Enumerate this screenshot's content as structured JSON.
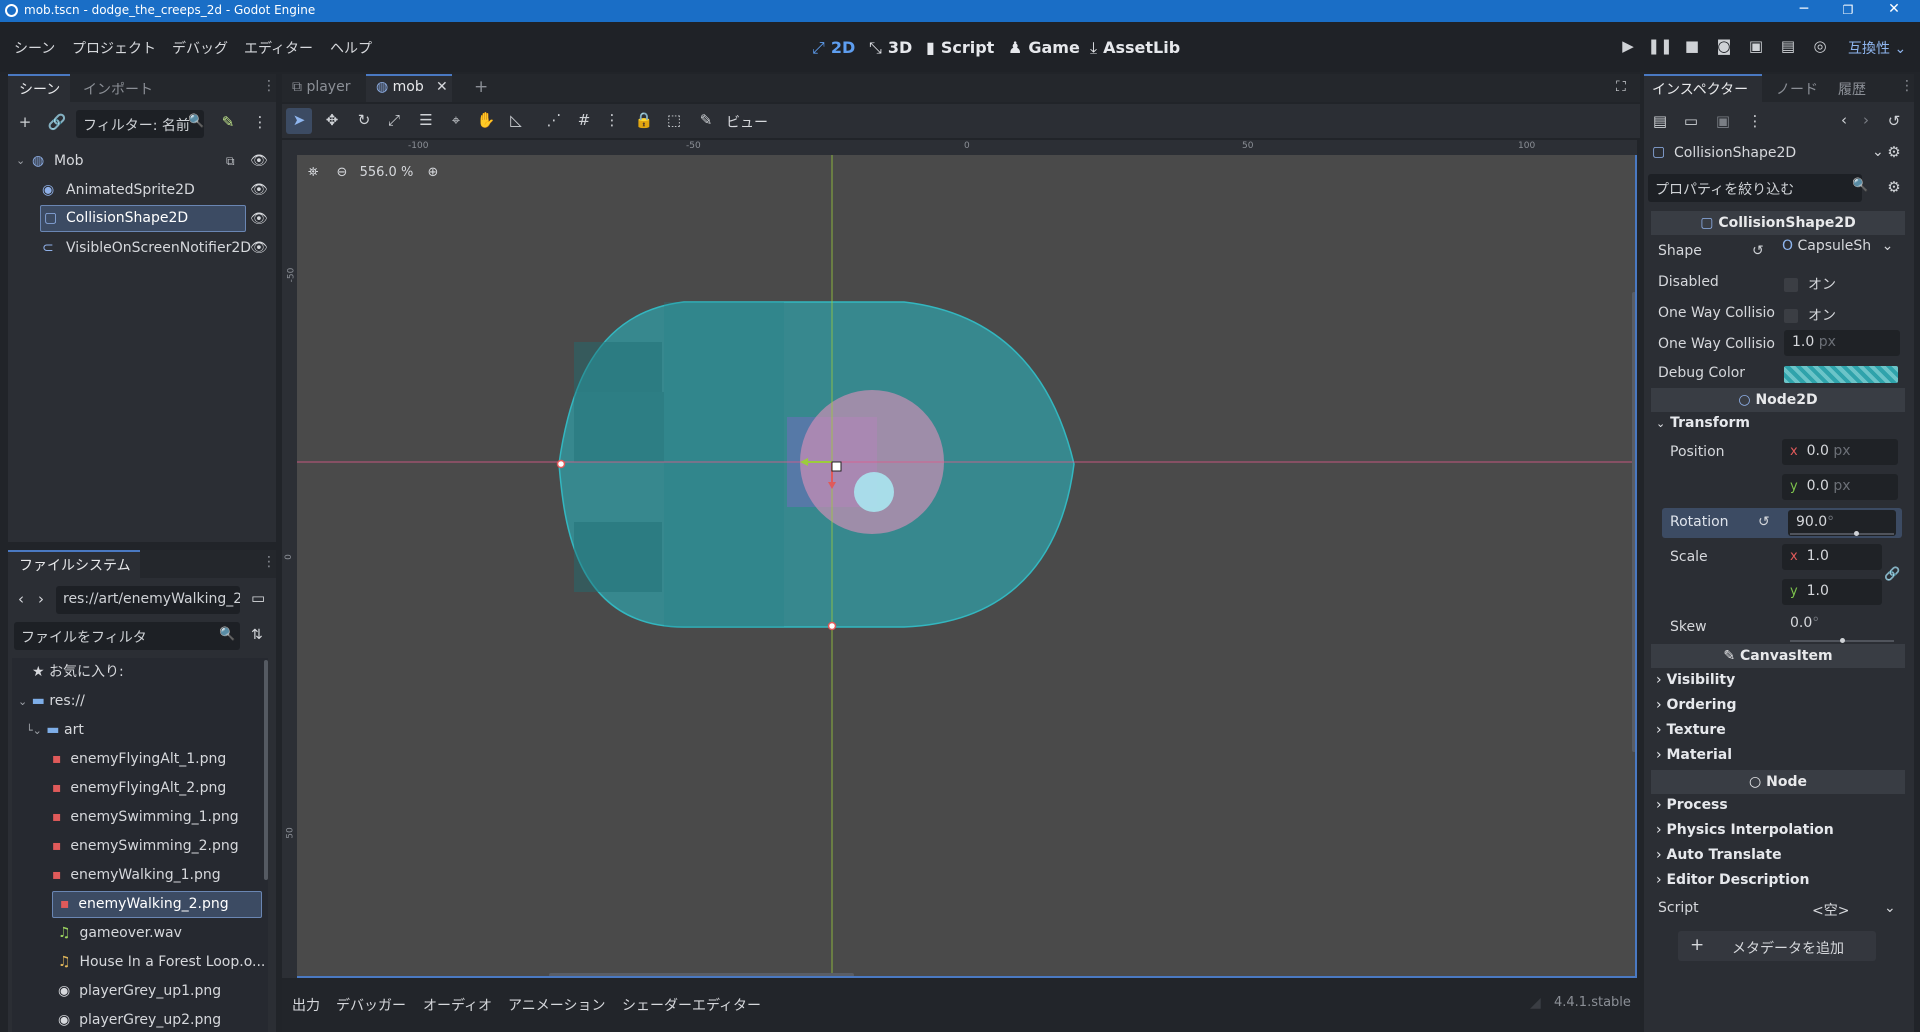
{
  "window": {
    "title": "mob.tscn - dodge_the_creeps_2d - Godot Engine"
  },
  "menu": [
    "シーン",
    "プロジェクト",
    "デバッグ",
    "エディター",
    "ヘルプ"
  ],
  "workspaces": [
    {
      "label": "2D",
      "icon": "2d-icon"
    },
    {
      "label": "3D",
      "icon": "3d-icon"
    },
    {
      "label": "Script",
      "icon": "script-icon"
    },
    {
      "label": "Game",
      "icon": "game-icon"
    },
    {
      "label": "AssetLib",
      "icon": "assetlib-icon"
    }
  ],
  "renderer": "互換性",
  "scene_dock": {
    "tabs": [
      "シーン",
      "インポート"
    ],
    "filter_placeholder": "フィルター: 名前",
    "nodes": [
      {
        "name": "Mob",
        "depth": 0
      },
      {
        "name": "AnimatedSprite2D",
        "depth": 1
      },
      {
        "name": "CollisionShape2D",
        "depth": 1,
        "selected": true
      },
      {
        "name": "VisibleOnScreenNotifier2D",
        "depth": 1
      }
    ]
  },
  "filesystem": {
    "title": "ファイルシステム",
    "path": "res://art/enemyWalking_2.",
    "filter_placeholder": "ファイルをフィルタ",
    "favorites": "お気に入り:",
    "root": "res://",
    "folder": "art",
    "files": [
      "enemyFlyingAlt_1.png",
      "enemyFlyingAlt_2.png",
      "enemySwimming_1.png",
      "enemySwimming_2.png",
      "enemyWalking_1.png",
      "enemyWalking_2.png",
      "gameover.wav",
      "House In a Forest Loop.o...",
      "playerGrey_up1.png",
      "playerGrey_up2.png"
    ],
    "selected_file": "enemyWalking_2.png"
  },
  "editor_tabs": [
    "player",
    "mob"
  ],
  "toolbar": {
    "view_label": "ビュー"
  },
  "viewport": {
    "zoom": "556.0 %",
    "ruler_labels": [
      "-100",
      "-50",
      "0",
      "50",
      "100"
    ],
    "vruler_labels": [
      "-50",
      "0",
      "50"
    ]
  },
  "bottom_tabs": [
    "出力",
    "デバッガー",
    "オーディオ",
    "アニメーション",
    "シェーダーエディター"
  ],
  "version": "4.4.1.stable",
  "inspector": {
    "tabs": [
      "インスペクター",
      "ノード",
      "履歴"
    ],
    "node_type": "CollisionShape2D",
    "filter_placeholder": "プロパティを絞り込む",
    "class_header": "CollisionShape2D",
    "shape_label": "Shape",
    "shape_value": "CapsuleSh",
    "disabled_label": "Disabled",
    "on_label": "オン",
    "owc_label": "One Way Collisio",
    "owc_margin_label": "One Way Collisio",
    "owc_margin_value": "1.0",
    "px_unit": "px",
    "debug_color_label": "Debug Color",
    "debug_color": "#00999980",
    "node2d_header": "Node2D",
    "transform_label": "Transform",
    "position_label": "Position",
    "position": {
      "x": "0.0",
      "y": "0.0"
    },
    "rotation_label": "Rotation",
    "rotation_value": "90.0",
    "degree_unit": "°",
    "scale_label": "Scale",
    "scale": {
      "x": "1.0",
      "y": "1.0"
    },
    "skew_label": "Skew",
    "skew_value": "0.0",
    "canvasitem_header": "CanvasItem",
    "canvas_categories": [
      "Visibility",
      "Ordering",
      "Texture",
      "Material"
    ],
    "node_header": "Node",
    "node_categories": [
      "Process",
      "Physics Interpolation",
      "Auto Translate",
      "Editor Description"
    ],
    "script_label": "Script",
    "script_value": "<空>",
    "add_metadata": "メタデータを追加"
  },
  "colors": {
    "accent": "#4a79c2",
    "title_bar": "#1a6ec6",
    "capsule": "#2fa3ab",
    "x_axis": "#e05a5a",
    "y_axis": "#9ccc3c"
  }
}
